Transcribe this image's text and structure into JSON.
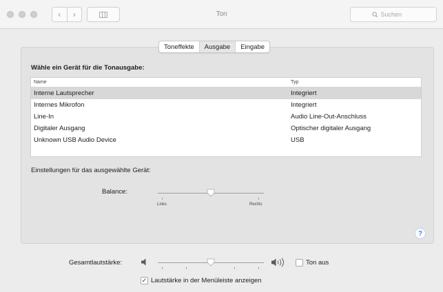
{
  "window": {
    "title": "Ton",
    "search_placeholder": "Suchen"
  },
  "tabs": [
    {
      "label": "Toneffekte",
      "selected": false
    },
    {
      "label": "Ausgabe",
      "selected": true
    },
    {
      "label": "Eingabe",
      "selected": false
    }
  ],
  "output": {
    "heading": "Wähle ein Gerät für die Tonausgabe:",
    "columns": {
      "name": "Name",
      "type": "Typ"
    },
    "devices": [
      {
        "name": "Interne Lautsprecher",
        "type": "Integriert",
        "selected": true
      },
      {
        "name": "Internes Mikrofon",
        "type": "Integriert",
        "selected": false
      },
      {
        "name": "Line-In",
        "type": "Audio Line-Out-Anschluss",
        "selected": false
      },
      {
        "name": "Digitaler Ausgang",
        "type": "Optischer digitaler Ausgang",
        "selected": false
      },
      {
        "name": "Unknown USB Audio Device",
        "type": "USB",
        "selected": false
      }
    ],
    "settings_label": "Einstellungen für das ausgewählte Gerät:",
    "balance": {
      "label": "Balance:",
      "left_label": "Links",
      "right_label": "Rechts",
      "value": 0.5
    },
    "help_symbol": "?"
  },
  "volume": {
    "label": "Gesamtlautstärke:",
    "value": 0.5,
    "mute_label": "Ton aus",
    "mute_checked": false,
    "menubar_label": "Lautstärke in der Menüleiste anzeigen",
    "menubar_checked": true,
    "check_glyph": "✓"
  },
  "icons": [
    "close-icon",
    "minimize-icon",
    "zoom-icon",
    "back-icon",
    "forward-icon",
    "grid-icon",
    "search-icon",
    "speaker-low-icon",
    "speaker-high-icon",
    "help-icon"
  ]
}
